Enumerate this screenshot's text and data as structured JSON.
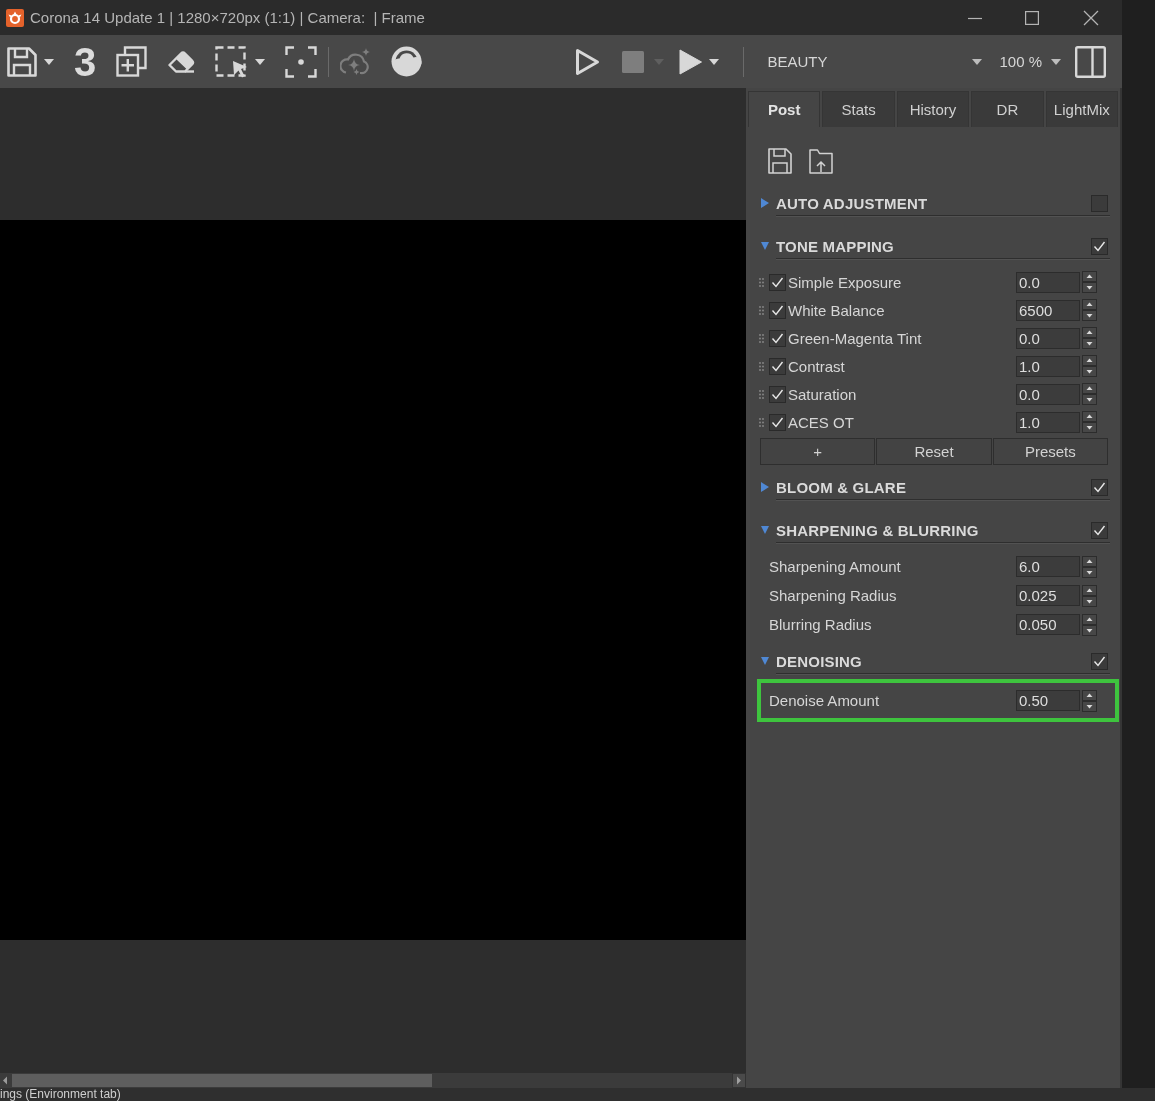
{
  "window": {
    "title": "Corona 14 Update 1 | 1280×720px (1:1) | Camera:  | Frame"
  },
  "toolbar": {
    "tools": [
      {
        "kind": "floppy",
        "dropdown": true,
        "disabled": false
      },
      {
        "kind": "digit",
        "label": "3",
        "dropdown": false,
        "disabled": false
      },
      {
        "kind": "stacked-squares",
        "dropdown": false,
        "disabled": false
      },
      {
        "kind": "eraser",
        "dropdown": false,
        "disabled": false
      },
      {
        "kind": "dashed-region",
        "dropdown": true,
        "disabled": false
      },
      {
        "kind": "dashed-corners",
        "dropdown": false,
        "disabled": false
      },
      {
        "kind": "separator"
      },
      {
        "kind": "sparkle-cloud",
        "dropdown": false,
        "disabled": true
      },
      {
        "kind": "cloud-disc",
        "dropdown": false,
        "disabled": false
      }
    ],
    "render_controls": [
      {
        "kind": "play-outline",
        "dropdown": false,
        "disabled": false
      },
      {
        "kind": "stop",
        "dropdown": true,
        "disabled": true
      },
      {
        "kind": "play",
        "dropdown": true,
        "disabled": false
      }
    ],
    "pass_select": {
      "value": "BEAUTY"
    },
    "zoom_select": {
      "value": "100 %"
    }
  },
  "panel": {
    "tabs": [
      {
        "label": "Post",
        "selected": true
      },
      {
        "label": "Stats",
        "selected": false
      },
      {
        "label": "History",
        "selected": false
      },
      {
        "label": "DR",
        "selected": false
      },
      {
        "label": "LightMix",
        "selected": false
      }
    ],
    "actions": [
      {
        "kind": "save"
      },
      {
        "kind": "folder-upload"
      }
    ],
    "sections": [
      {
        "title": "AUTO ADJUSTMENT",
        "expanded": false,
        "enabled": false
      },
      {
        "title": "TONE MAPPING",
        "expanded": true,
        "enabled": true,
        "operators": [
          {
            "label": "Simple Exposure",
            "checked": true,
            "value": "0.0"
          },
          {
            "label": "White Balance",
            "checked": true,
            "value": "6500"
          },
          {
            "label": "Green-Magenta Tint",
            "checked": true,
            "value": "0.0"
          },
          {
            "label": "Contrast",
            "checked": true,
            "value": "1.0"
          },
          {
            "label": "Saturation",
            "checked": true,
            "value": "0.0"
          },
          {
            "label": "ACES OT",
            "checked": true,
            "value": "1.0"
          }
        ],
        "buttons": [
          "+",
          "Reset",
          "Presets"
        ]
      },
      {
        "title": "BLOOM & GLARE",
        "expanded": false,
        "enabled": true
      },
      {
        "title": "SHARPENING & BLURRING",
        "expanded": true,
        "enabled": true,
        "params": [
          {
            "label": "Sharpening Amount",
            "value": "6.0",
            "highlighted": false
          },
          {
            "label": "Sharpening Radius",
            "value": "0.025",
            "highlighted": false
          },
          {
            "label": "Blurring Radius",
            "value": "0.050",
            "highlighted": false
          }
        ]
      },
      {
        "title": "DENOISING",
        "expanded": true,
        "enabled": true,
        "params": [
          {
            "label": "Denoise Amount",
            "value": "0.50",
            "highlighted": true
          }
        ]
      }
    ]
  },
  "status_strip": {
    "text": "ings (Environment tab)"
  }
}
